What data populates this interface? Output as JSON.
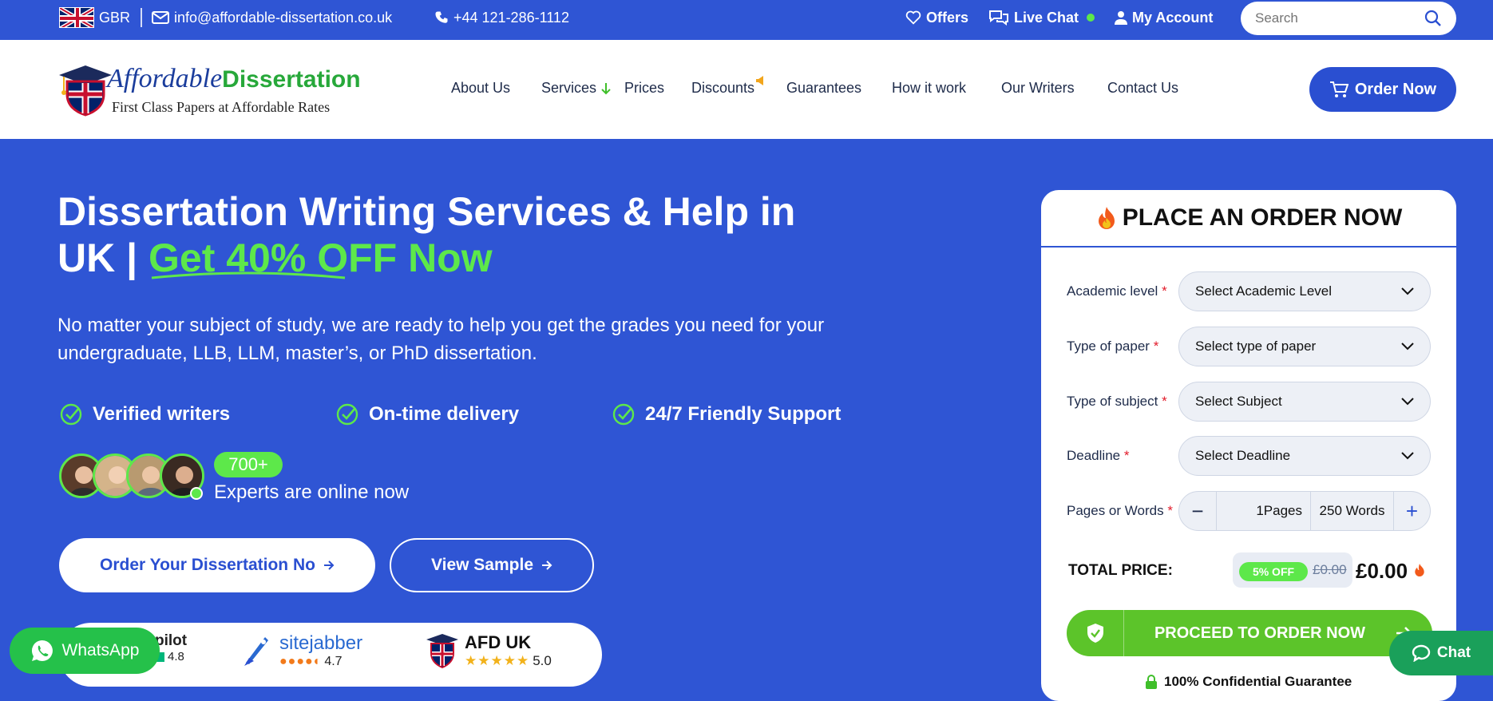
{
  "topbar": {
    "country": "GBR",
    "email": "info@affordable-dissertation.co.uk",
    "phone": "+44 121-286-1112",
    "offers": "Offers",
    "live_chat": "Live Chat",
    "my_account": "My Account",
    "search_placeholder": "Search"
  },
  "logo": {
    "brand_part1": "Affordable",
    "brand_part2": "Dissertation",
    "tagline": "First Class Papers at Affordable Rates"
  },
  "nav": {
    "items": [
      "About Us",
      "Services",
      "Prices",
      "Discounts",
      "Guarantees",
      "How it work",
      "Our Writers",
      "Contact Us"
    ],
    "order_button": "Order Now"
  },
  "hero": {
    "title_line1": "Dissertation Writing Services & Help in",
    "title_line2_prefix": "UK | ",
    "title_highlight": "Get 40% OFF Now",
    "subtitle": "No matter your subject of study, we are ready to help you get the grades you need for your undergraduate, LLB, LLM, master’s, or PhD dissertation.",
    "features": [
      "Verified writers",
      "On-time delivery",
      "24/7 Friendly Support"
    ],
    "experts_count": "700+",
    "experts_text": "Experts are online now",
    "primary_button": "Order Your Dissertation No",
    "secondary_button": "View Sample"
  },
  "reviews": {
    "trustpilot": {
      "name": "pilot",
      "rating": "4.8"
    },
    "sitejabber": {
      "name": "sitejabber",
      "rating": "4.7"
    },
    "afd": {
      "name": "AFD UK",
      "rating": "5.0"
    }
  },
  "floating": {
    "whatsapp": "WhatsApp",
    "chat": "Chat"
  },
  "order_form": {
    "title": "PLACE AN ORDER NOW",
    "fields": [
      {
        "label": "Academic level",
        "value": "Select Academic Level"
      },
      {
        "label": "Type of paper",
        "value": "Select type of paper"
      },
      {
        "label": "Type of subject",
        "value": "Select Subject"
      },
      {
        "label": "Deadline",
        "value": "Select Deadline"
      }
    ],
    "pages_label": "Pages or Words",
    "pages_value": "1Pages",
    "words_value": "250 Words",
    "minus": "−",
    "plus": "+",
    "total_label": "TOTAL PRICE:",
    "discount_badge": "5% OFF",
    "old_price": "£0.00",
    "new_price": "£0.00",
    "proceed_button": "PROCEED TO ORDER NOW",
    "guarantee": "100% Confidential Guarantee"
  },
  "colors": {
    "brand_blue": "#2f55d4",
    "accent_green": "#5de84a",
    "whatsapp_green": "#25c14a"
  }
}
